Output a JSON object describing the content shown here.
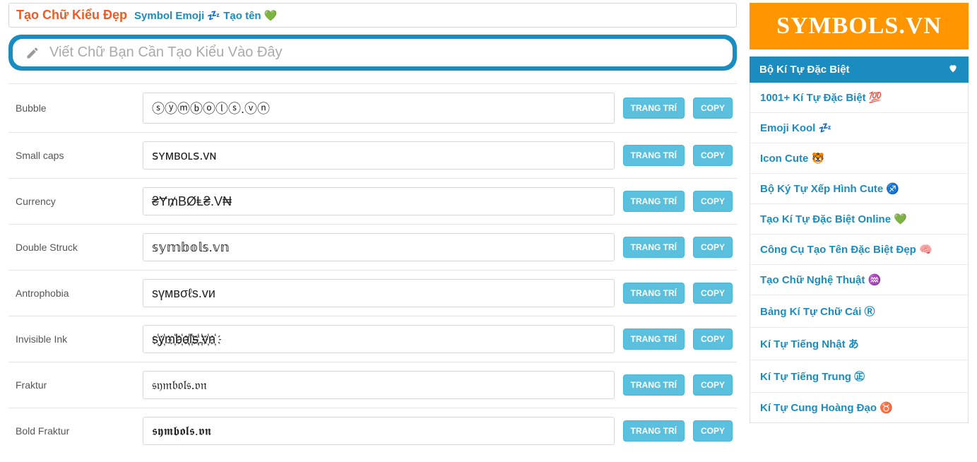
{
  "header": {
    "title": "Tạo Chữ Kiểu Đẹp",
    "subtitle": "Symbol Emoji 💤 Tạo tên 💚"
  },
  "input": {
    "placeholder": "Viết Chữ Bạn Cần Tạo Kiểu Vào Đây"
  },
  "buttons": {
    "decorate": "TRANG TRÍ",
    "copy": "COPY"
  },
  "styles": [
    {
      "label": "Bubble",
      "value": "ⓢⓨⓜⓑⓞⓛⓢ.ⓥⓝ"
    },
    {
      "label": "Small caps",
      "value": "ꜱʏᴍʙᴏʟꜱ.ᴠɴ"
    },
    {
      "label": "Currency",
      "value": "₴Ɏ₥ΒØⱠ₴.V₦"
    },
    {
      "label": "Double Struck",
      "value": "𝕤𝕪𝕞𝕓𝕠𝕝𝕤.𝕧𝕟"
    },
    {
      "label": "Antrophobia",
      "value": "sүмвσℓs.vи"
    },
    {
      "label": "Invisible Ink",
      "value": "s҉y҉m҉b҉o҉l҉s҉.҉v҉n҉"
    },
    {
      "label": "Fraktur",
      "value": "𝔰𝔶𝔪𝔟𝔬𝔩𝔰.𝔳𝔫"
    },
    {
      "label": "Bold Fraktur",
      "value": "𝖘𝖞𝖒𝖇𝖔𝖑𝖘.𝖛𝖓"
    }
  ],
  "sidebar": {
    "logo": "SYMBOLS.VN",
    "panel_title": "Bộ Kí Tự Đặc Biệt",
    "items": [
      {
        "label": "1001+ Kí Tự Đặc Biệt 💯",
        "active": false
      },
      {
        "label": "Emoji Kool 💤",
        "active": false
      },
      {
        "label": "Icon Cute 🐯",
        "active": false
      },
      {
        "label": "Bộ Ký Tự Xếp Hình Cute ♐",
        "active": false
      },
      {
        "label": "Tạo Kí Tự Đặc Biệt Online 💚",
        "active": false
      },
      {
        "label": "Công Cụ Tạo Tên Đặc Biệt Đẹp 🧠",
        "active": false
      },
      {
        "label": "Tạo Chữ Nghệ Thuật ♒",
        "active": true
      },
      {
        "label": "Bảng Kí Tự Chữ Cái Ⓡ",
        "active": false
      },
      {
        "label": "Kí Tự Tiếng Nhật あ",
        "active": false
      },
      {
        "label": "Kí Tự Tiếng Trung ㊣",
        "active": false
      },
      {
        "label": "Kí Tự Cung Hoàng Đạo ♉",
        "active": false
      }
    ]
  }
}
